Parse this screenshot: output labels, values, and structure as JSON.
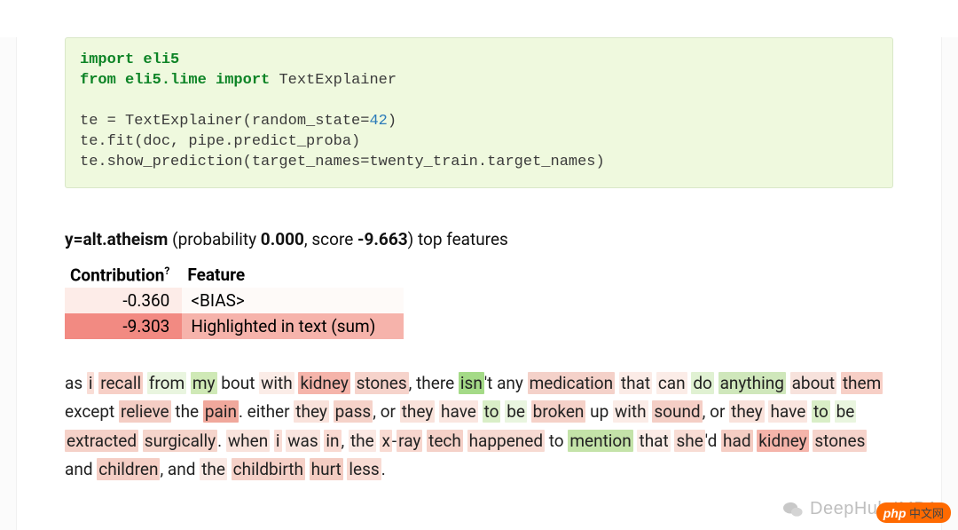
{
  "code": {
    "l1_1": "import",
    "l1_2": " eli5",
    "l2_1": "from",
    "l2_2": " eli5.lime ",
    "l2_3": "import",
    "l2_4": " TextExplainer",
    "l3_1": "te = TextExplainer(random_state=",
    "l3_2": "42",
    "l3_3": ")",
    "l4": "te.fit(doc, pipe.predict_proba)",
    "l5": "te.show_prediction(target_names=twenty_train.target_names)"
  },
  "header": {
    "y_label": "y=alt.atheism",
    "prob_prefix": " (probability ",
    "prob_val": "0.000",
    "score_prefix": ", score ",
    "score_val": "-9.663",
    "suffix": ") top features"
  },
  "table": {
    "col1": "Contribution",
    "sup": "?",
    "col2": "Feature",
    "rows": [
      {
        "c": "-0.360",
        "f": "<BIAS>",
        "bg_l": "#fdece8",
        "bg_r": "#fefaf8"
      },
      {
        "c": "-9.303",
        "f": "Highlighted in text (sum)",
        "bg_l": "#f28a82",
        "bg_r": "#f6b3ab"
      }
    ]
  },
  "text": {
    "words": [
      {
        "t": "as ",
        "c": ""
      },
      {
        "t": "i",
        "c": "#f9ddd6"
      },
      {
        "t": " ",
        "c": ""
      },
      {
        "t": "recall",
        "c": "#f7cfc6"
      },
      {
        "t": " ",
        "c": ""
      },
      {
        "t": "from",
        "c": "#e9f5df"
      },
      {
        "t": " ",
        "c": ""
      },
      {
        "t": "my",
        "c": "#cfe9b6"
      },
      {
        "t": " bout ",
        "c": ""
      },
      {
        "t": "with",
        "c": "#fbece7"
      },
      {
        "t": " ",
        "c": ""
      },
      {
        "t": "kidney",
        "c": "#f5b4aa"
      },
      {
        "t": " ",
        "c": ""
      },
      {
        "t": "stones",
        "c": "#f6d3cb"
      },
      {
        "t": ", there ",
        "c": ""
      },
      {
        "t": "isn",
        "c": "#a4da87"
      },
      {
        "t": "'t",
        "c": ""
      },
      {
        "t": " any ",
        "c": ""
      },
      {
        "t": "medication",
        "c": "#f4d1c9"
      },
      {
        "t": " ",
        "c": ""
      },
      {
        "t": "that",
        "c": "#fbebe6"
      },
      {
        "t": " ",
        "c": ""
      },
      {
        "t": "can",
        "c": "#fbece7"
      },
      {
        "t": " ",
        "c": ""
      },
      {
        "t": "do",
        "c": "#e0f1d2"
      },
      {
        "t": " ",
        "c": ""
      },
      {
        "t": "anything",
        "c": "#cfe7bb"
      },
      {
        "t": " ",
        "c": ""
      },
      {
        "t": "about",
        "c": "#f7e2dc"
      },
      {
        "t": " ",
        "c": ""
      },
      {
        "t": "them",
        "c": "#f7cfc6"
      },
      {
        "t": " except ",
        "c": ""
      },
      {
        "t": "relieve",
        "c": "#f4cdc4"
      },
      {
        "t": " the ",
        "c": ""
      },
      {
        "t": "pain",
        "c": "#f0a89c"
      },
      {
        "t": ". either ",
        "c": ""
      },
      {
        "t": "they",
        "c": "#f9e2db"
      },
      {
        "t": " ",
        "c": ""
      },
      {
        "t": "pass",
        "c": "#f5d2c9"
      },
      {
        "t": ", or ",
        "c": ""
      },
      {
        "t": "they",
        "c": "#f9e2db"
      },
      {
        "t": " ",
        "c": ""
      },
      {
        "t": "have",
        "c": "#fae6e0"
      },
      {
        "t": " ",
        "c": ""
      },
      {
        "t": "to",
        "c": "#d9eec7"
      },
      {
        "t": " ",
        "c": ""
      },
      {
        "t": "be",
        "c": "#e9f5df"
      },
      {
        "t": " ",
        "c": ""
      },
      {
        "t": "broken",
        "c": "#f5d1c8"
      },
      {
        "t": " up ",
        "c": ""
      },
      {
        "t": "with",
        "c": "#fbece7"
      },
      {
        "t": " ",
        "c": ""
      },
      {
        "t": "sound",
        "c": "#f4cec5"
      },
      {
        "t": ", or ",
        "c": ""
      },
      {
        "t": "they",
        "c": "#f9e2db"
      },
      {
        "t": " ",
        "c": ""
      },
      {
        "t": "have",
        "c": "#fae6e0"
      },
      {
        "t": " ",
        "c": ""
      },
      {
        "t": "to",
        "c": "#d9eec7"
      },
      {
        "t": " ",
        "c": ""
      },
      {
        "t": "be",
        "c": "#e9f5df"
      },
      {
        "t": " ",
        "c": ""
      },
      {
        "t": "extracted",
        "c": "#f5d1c8"
      },
      {
        "t": " ",
        "c": ""
      },
      {
        "t": "surgically",
        "c": "#f5d4cb"
      },
      {
        "t": ". ",
        "c": ""
      },
      {
        "t": "when",
        "c": "#f9e3dc"
      },
      {
        "t": " ",
        "c": ""
      },
      {
        "t": "i",
        "c": "#f9ddd6"
      },
      {
        "t": " ",
        "c": ""
      },
      {
        "t": "was",
        "c": "#fae5df"
      },
      {
        "t": " ",
        "c": ""
      },
      {
        "t": "in",
        "c": "#f9dad2"
      },
      {
        "t": ", ",
        "c": ""
      },
      {
        "t": "the",
        "c": "#fae8e3"
      },
      {
        "t": " ",
        "c": ""
      },
      {
        "t": "x",
        "c": "#f9dbd3"
      },
      {
        "t": "-",
        "c": ""
      },
      {
        "t": "ray",
        "c": "#f7d6ce"
      },
      {
        "t": " ",
        "c": ""
      },
      {
        "t": "tech",
        "c": "#f5d1c8"
      },
      {
        "t": " ",
        "c": ""
      },
      {
        "t": "happened",
        "c": "#f7dad2"
      },
      {
        "t": " to ",
        "c": ""
      },
      {
        "t": "mention",
        "c": "#c4e3a9"
      },
      {
        "t": " ",
        "c": ""
      },
      {
        "t": "that",
        "c": "#fbebe6"
      },
      {
        "t": " ",
        "c": ""
      },
      {
        "t": "she",
        "c": "#f8dcd4"
      },
      {
        "t": "'d",
        "c": ""
      },
      {
        "t": " ",
        "c": ""
      },
      {
        "t": "had",
        "c": "#f5cdc3"
      },
      {
        "t": " ",
        "c": ""
      },
      {
        "t": "kidney",
        "c": "#f5b4aa"
      },
      {
        "t": " ",
        "c": ""
      },
      {
        "t": "stones",
        "c": "#f6d3cb"
      },
      {
        "t": " and ",
        "c": ""
      },
      {
        "t": "children",
        "c": "#f5cec5"
      },
      {
        "t": ", and ",
        "c": ""
      },
      {
        "t": "the",
        "c": "#fae8e3"
      },
      {
        "t": " ",
        "c": ""
      },
      {
        "t": "childbirth",
        "c": "#f5d0c7"
      },
      {
        "t": " ",
        "c": ""
      },
      {
        "t": "hurt",
        "c": "#f4ccc2"
      },
      {
        "t": " ",
        "c": ""
      },
      {
        "t": "less",
        "c": "#f8dbd3"
      },
      {
        "t": ".",
        "c": ""
      }
    ]
  },
  "watermark": {
    "text": "DeepHub IMBA",
    "php": "php",
    "cn": " 中文网"
  }
}
